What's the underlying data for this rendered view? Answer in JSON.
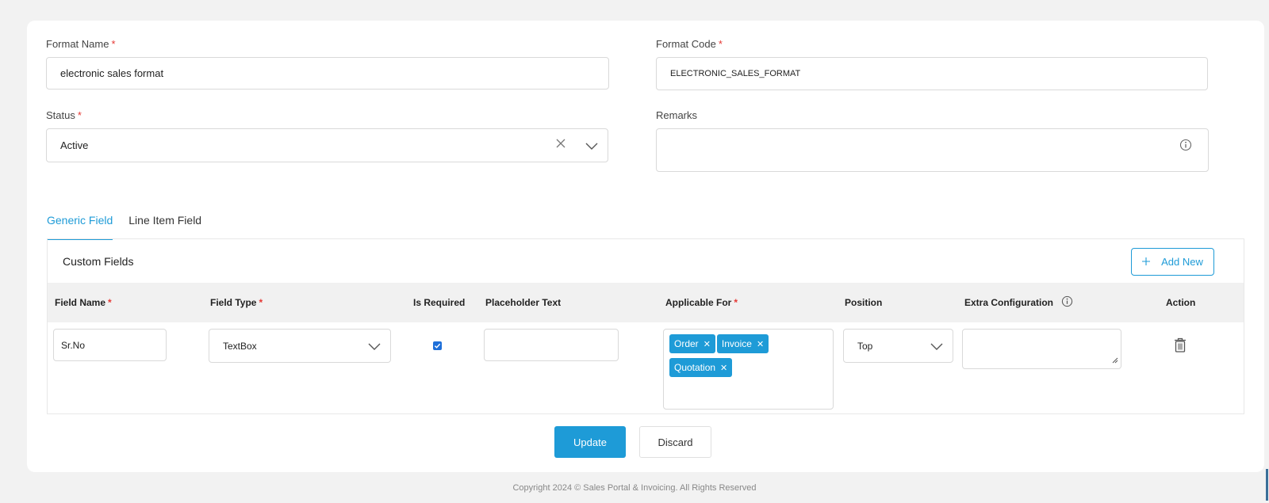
{
  "form": {
    "format_name_label": "Format Name",
    "format_name_value": "electronic sales format",
    "format_code_label": "Format Code",
    "format_code_value": "ELECTRONIC_SALES_FORMAT",
    "status_label": "Status",
    "status_value": "Active",
    "remarks_label": "Remarks",
    "required_mark": "*"
  },
  "tabs": [
    {
      "label": "Generic Field",
      "active": true
    },
    {
      "label": "Line Item Field",
      "active": false
    }
  ],
  "custom_fields": {
    "title": "Custom Fields",
    "add_new_label": "Add New",
    "columns": {
      "field_name": "Field Name",
      "field_type": "Field Type",
      "is_required": "Is Required",
      "placeholder_text": "Placeholder Text",
      "applicable_for": "Applicable For",
      "position": "Position",
      "extra_configuration": "Extra Configuration",
      "action": "Action"
    },
    "rows": [
      {
        "field_name": "Sr.No",
        "field_type": "TextBox",
        "is_required": true,
        "placeholder_text": "",
        "applicable_for": [
          "Order",
          "Invoice",
          "Quotation"
        ],
        "position": "Top",
        "extra_configuration": ""
      }
    ]
  },
  "actions": {
    "update_label": "Update",
    "discard_label": "Discard"
  },
  "footer": {
    "copyright": "Copyright 2024 © Sales Portal & Invoicing. All Rights Reserved"
  },
  "colors": {
    "accent": "#1e9bd7",
    "required": "#e53935"
  }
}
